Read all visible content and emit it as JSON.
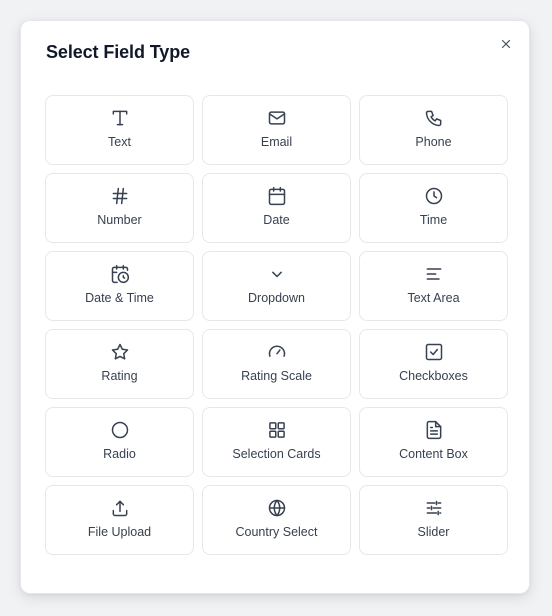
{
  "dialog": {
    "title": "Select Field Type",
    "close_icon": "close-icon"
  },
  "field_types": [
    {
      "label": "Text",
      "icon": "text-icon"
    },
    {
      "label": "Email",
      "icon": "mail-icon"
    },
    {
      "label": "Phone",
      "icon": "phone-icon"
    },
    {
      "label": "Number",
      "icon": "hash-icon"
    },
    {
      "label": "Date",
      "icon": "calendar-icon"
    },
    {
      "label": "Time",
      "icon": "clock-icon"
    },
    {
      "label": "Date & Time",
      "icon": "calendar-clock-icon"
    },
    {
      "label": "Dropdown",
      "icon": "chevron-down-icon"
    },
    {
      "label": "Text Area",
      "icon": "align-left-icon"
    },
    {
      "label": "Rating",
      "icon": "star-icon"
    },
    {
      "label": "Rating Scale",
      "icon": "gauge-icon"
    },
    {
      "label": "Checkboxes",
      "icon": "check-square-icon"
    },
    {
      "label": "Radio",
      "icon": "circle-icon"
    },
    {
      "label": "Selection Cards",
      "icon": "layout-grid-icon"
    },
    {
      "label": "Content Box",
      "icon": "file-text-icon"
    },
    {
      "label": "File Upload",
      "icon": "upload-icon"
    },
    {
      "label": "Country Select",
      "icon": "globe-icon"
    },
    {
      "label": "Slider",
      "icon": "sliders-icon"
    }
  ],
  "colors": {
    "icon_stroke": "#374151",
    "card_border": "#e5e7eb",
    "title": "#111827"
  }
}
